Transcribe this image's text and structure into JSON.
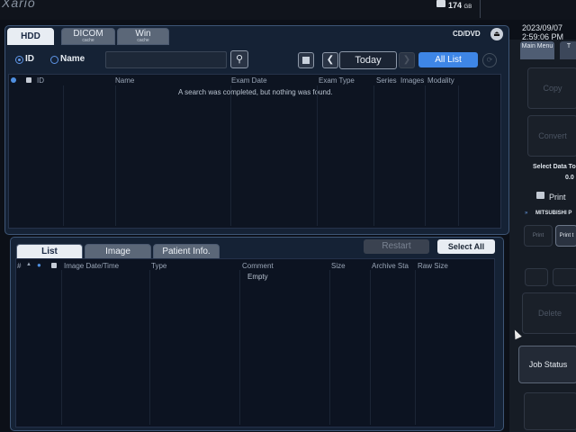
{
  "app": {
    "brand": "Xario"
  },
  "status": {
    "disk_value": "174",
    "disk_unit": "GB",
    "date": "2023/09/07",
    "time": "2:59:06 PM"
  },
  "top_tabs": [
    {
      "label": "HDD",
      "sub": ""
    },
    {
      "label": "DICOM",
      "sub": "cache"
    },
    {
      "label": "Win",
      "sub": "cache"
    }
  ],
  "media": {
    "label": "CD/DVD",
    "eject": "⏏"
  },
  "search": {
    "radio_id": "ID",
    "radio_name": "Name",
    "value": "",
    "search_icon": "⚲"
  },
  "nav": {
    "prev": "❮",
    "next": "❯",
    "today": "Today",
    "all_list": "All List",
    "extra": "⟳"
  },
  "study_table": {
    "columns": [
      "ID",
      "Name",
      "Exam Date",
      "Exam Type",
      "Series",
      "Images",
      "Modality"
    ],
    "message": "A search was completed, but nothing was found."
  },
  "bottom_tabs": [
    "List",
    "Image",
    "Patient Info."
  ],
  "bottom_actions": {
    "restart": "Restart",
    "select_all": "Select All"
  },
  "image_table": {
    "columns": [
      "#",
      "▲",
      "●",
      "🔒",
      "Image Date/Time",
      "Type",
      "Comment",
      "Size",
      "Archive Sta",
      "Raw Size"
    ],
    "message": "Empty"
  },
  "side_tabs": [
    {
      "label": "Main Menu"
    },
    {
      "label": "T"
    }
  ],
  "side": {
    "copy": "Copy",
    "convert": "Convert",
    "select_data": "Select Data To",
    "select_value": "0.0",
    "print_label": "Print",
    "printer": "MITSUBISHI P",
    "print_small": "Print",
    "print_to": "Print t",
    "delete": "Delete",
    "job_status": "Job Status"
  },
  "icons": {
    "disk": "hdd-icon",
    "lock": "lock-icon"
  }
}
